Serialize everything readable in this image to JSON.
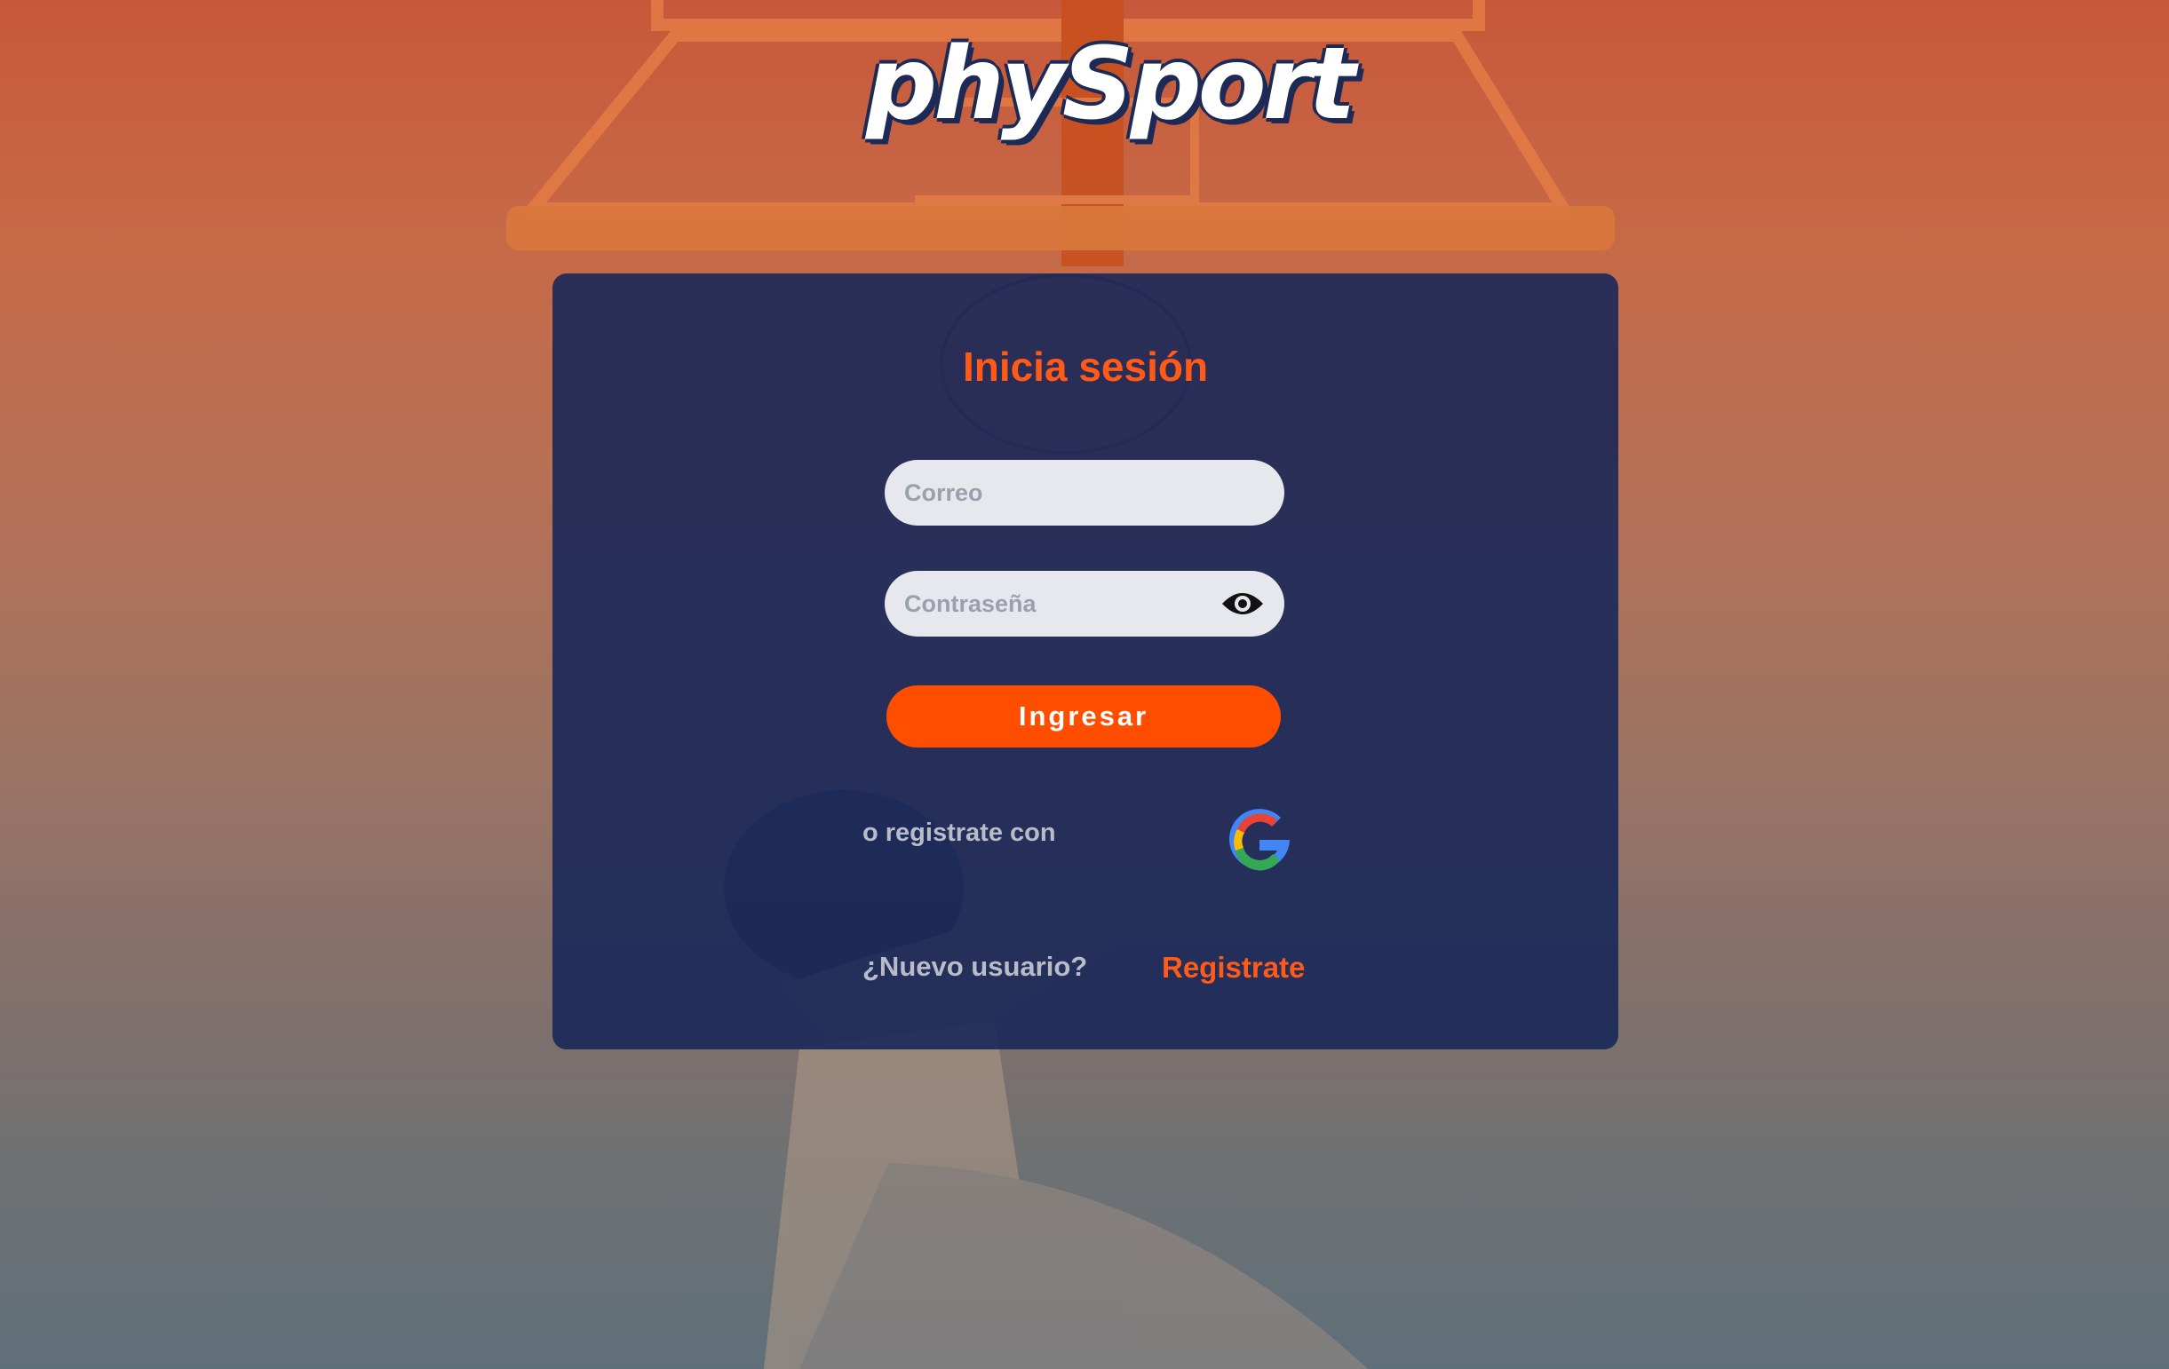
{
  "brand": {
    "logo_text": "phySport"
  },
  "login": {
    "title": "Inicia sesión",
    "email_placeholder": "Correo",
    "password_placeholder": "Contraseña",
    "submit_label": "Ingresar",
    "alt_signup_text": "o registrate con",
    "new_user_text": "¿Nuevo usuario?",
    "register_link": "Registrate"
  },
  "icons": {
    "password_toggle": "eye-icon",
    "google": "google-icon"
  },
  "colors": {
    "accent": "#ff4e00",
    "card": "#162658",
    "input_bg": "#e6e8ee",
    "muted_text": "#b8bcc8"
  }
}
